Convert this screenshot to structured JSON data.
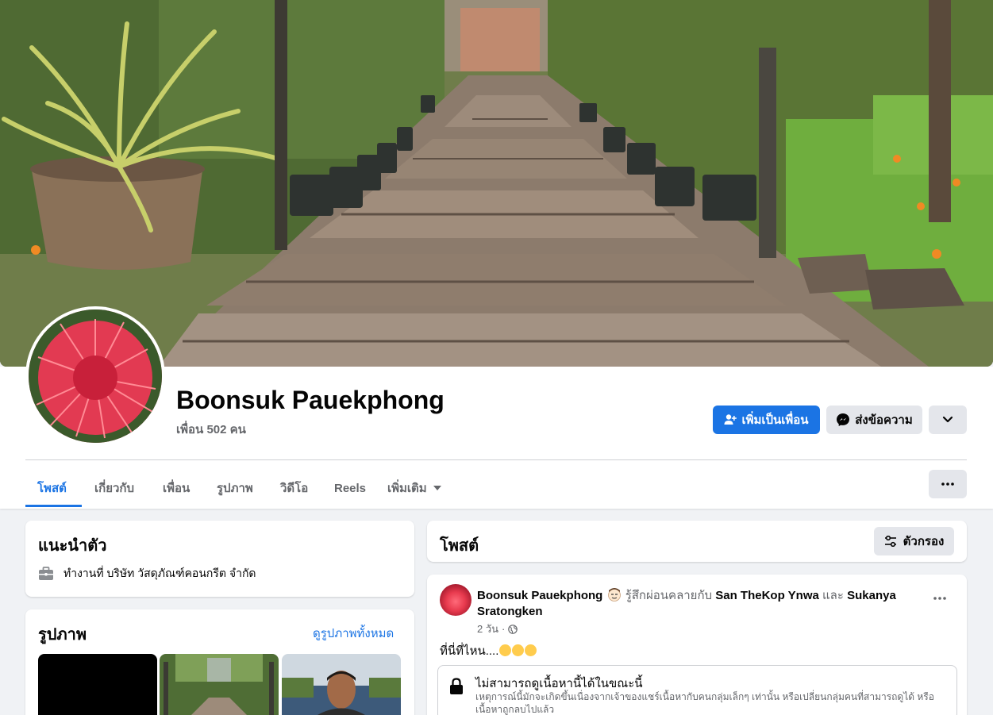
{
  "profile": {
    "name": "Boonsuk Pauekphong",
    "friends_text": "เพื่อน 502 คน"
  },
  "actions": {
    "add_friend": "เพิ่มเป็นเพื่อน",
    "message": "ส่งข้อความ"
  },
  "tabs": [
    {
      "label": "โพสต์",
      "active": true
    },
    {
      "label": "เกี่ยวกับ"
    },
    {
      "label": "เพื่อน"
    },
    {
      "label": "รูปภาพ"
    },
    {
      "label": "วิดีโอ"
    },
    {
      "label": "Reels"
    },
    {
      "label": "เพิ่มเติม"
    }
  ],
  "intro": {
    "title": "แนะนำตัว",
    "work": "ทำงานที่ บริษัท วัสดุภัณฑ์คอนกรีต จำกัด"
  },
  "photos": {
    "title": "รูปภาพ",
    "see_all": "ดูรูปภาพทั้งหมด"
  },
  "posts_section": {
    "title": "โพสต์",
    "filter": "ตัวกรอง"
  },
  "post": {
    "author": "Boonsuk Pauekphong",
    "feeling": "รู้สึกผ่อนคลายกับ",
    "tag1": "San TheKop Ynwa",
    "and": "และ",
    "tag2": "Sukanya Sratongken",
    "time": "2 วัน",
    "text": "ที่นี่ที่ไหน....",
    "unavailable_title": "ไม่สามารถดูเนื้อหานี้ได้ในขณะนี้",
    "unavailable_desc": "เหตุการณ์นี้มักจะเกิดขึ้นเนื่องจากเจ้าของแชร์เนื้อหากับคนกลุ่มเล็กๆ เท่านั้น หรือเปลี่ยนกลุ่มคนที่สามารถดูได้ หรือเนื้อหาถูกลบไปแล้ว"
  },
  "colors": {
    "accent": "#1b74e4",
    "background": "#f0f2f5",
    "secondary_text": "#65676b"
  }
}
